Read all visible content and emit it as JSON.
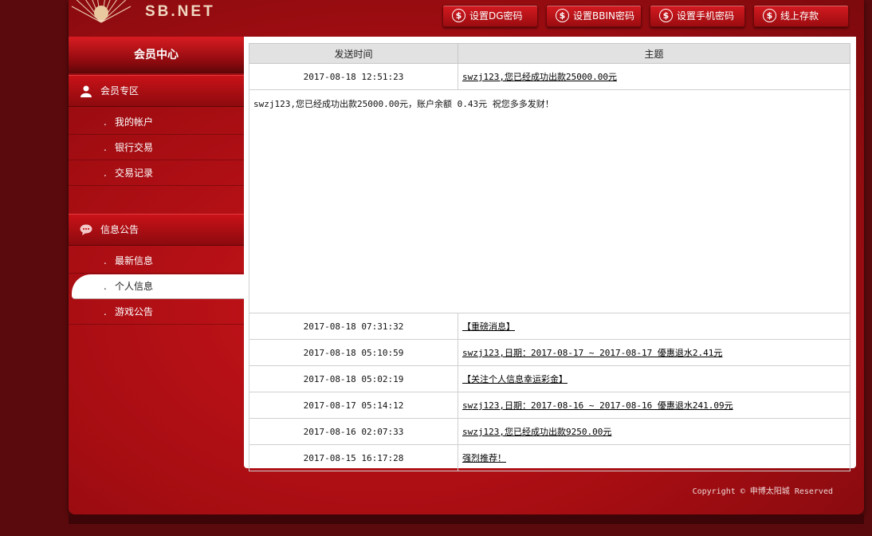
{
  "logo": {
    "text": "SB.NET",
    "cn": "申博太阳城"
  },
  "topnav": [
    {
      "label": "设置DG密码"
    },
    {
      "label": "设置BBIN密码"
    },
    {
      "label": "设置手机密码"
    },
    {
      "label": "线上存款"
    }
  ],
  "sidebar": {
    "title": "会员中心",
    "sections": [
      {
        "label": "会员专区",
        "icon": "user-icon",
        "items": [
          {
            "label": "我的帐户"
          },
          {
            "label": "银行交易"
          },
          {
            "label": "交易记录"
          }
        ]
      },
      {
        "label": "信息公告",
        "icon": "chat-bubble-icon",
        "items": [
          {
            "label": "最新信息"
          },
          {
            "label": "个人信息",
            "active": true
          },
          {
            "label": "游戏公告"
          }
        ]
      }
    ]
  },
  "table": {
    "headers": {
      "time": "发送时间",
      "subject": "主题"
    },
    "rows": [
      {
        "time": "2017-08-18 12:51:23",
        "subject": "swzj123,您已经成功出款25000.00元"
      },
      {
        "time": "2017-08-18 07:31:32",
        "subject": "【重磅消息】"
      },
      {
        "time": "2017-08-18 05:10:59",
        "subject": "swzj123,日期：2017-08-17 ~ 2017-08-17 優惠退水2.41元"
      },
      {
        "time": "2017-08-18 05:02:19",
        "subject": "【关注个人信息幸运彩金】"
      },
      {
        "time": "2017-08-17 05:14:12",
        "subject": "swzj123,日期：2017-08-16 ~ 2017-08-16 優惠退水241.09元"
      },
      {
        "time": "2017-08-16 02:07:33",
        "subject": "swzj123,您已经成功出款9250.00元"
      },
      {
        "time": "2017-08-15 16:17:28",
        "subject": "强烈推荐！"
      }
    ],
    "expanded_body": "swzj123,您已经成功出款25000.00元，账户余额 0.43元 祝您多多发财！"
  },
  "footer": {
    "copyright": "Copyright © 申博太阳城 Reserved"
  },
  "colors": {
    "brand_red": "#c8141a",
    "dark_red": "#5a0a0c"
  }
}
